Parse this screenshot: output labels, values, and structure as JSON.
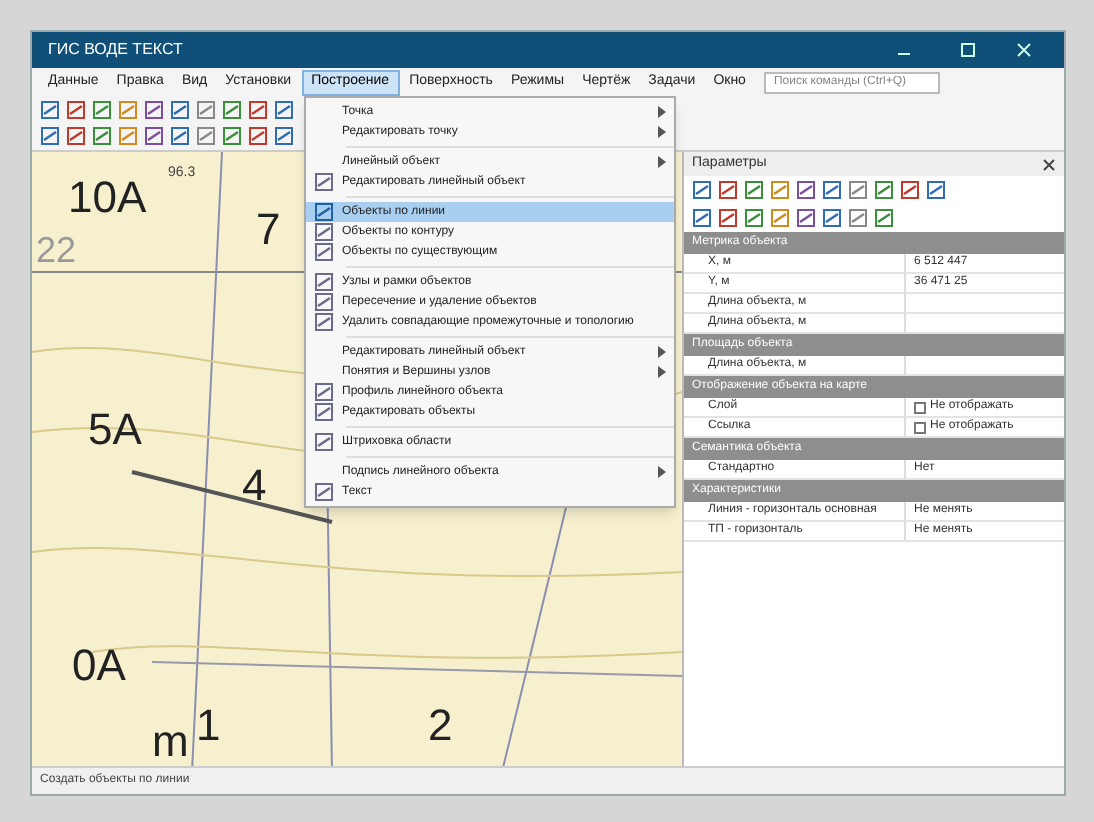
{
  "window": {
    "title": "ГИС ВОДЕ ТЕКСТ"
  },
  "menu_bar": [
    {
      "label": "Данные",
      "selected": false
    },
    {
      "label": "Правка",
      "selected": false
    },
    {
      "label": "Вид",
      "selected": false
    },
    {
      "label": "Установки",
      "selected": false
    },
    {
      "label": "Построение",
      "selected": true
    },
    {
      "label": "Поверхность",
      "selected": false
    },
    {
      "label": "Режимы",
      "selected": false
    },
    {
      "label": "Чертёж",
      "selected": false
    },
    {
      "label": "Задачи",
      "selected": false
    },
    {
      "label": "Окно",
      "selected": false
    }
  ],
  "search": {
    "placeholder": "Поиск команды (Ctrl+Q)"
  },
  "map": {
    "labels": [
      {
        "text": "10A",
        "kind": "big"
      },
      {
        "text": "96.3",
        "kind": "small"
      },
      {
        "text": "7",
        "kind": "big"
      },
      {
        "text": "22",
        "kind": "grid"
      },
      {
        "text": "5A",
        "kind": "big"
      },
      {
        "text": "4",
        "kind": "big"
      },
      {
        "text": "0A",
        "kind": "big"
      },
      {
        "text": "1",
        "kind": "big"
      },
      {
        "text": "2",
        "kind": "big"
      },
      {
        "text": "m",
        "kind": "big"
      }
    ]
  },
  "menu": [
    {
      "kind": "item",
      "label": "Точка",
      "submenu": true,
      "selected": false,
      "icon": false
    },
    {
      "kind": "item",
      "label": "Редактировать точку",
      "submenu": true,
      "selected": false,
      "icon": false
    },
    {
      "kind": "separator"
    },
    {
      "kind": "item",
      "label": "Линейный объект",
      "submenu": true,
      "selected": false,
      "icon": false
    },
    {
      "kind": "item",
      "label": "Редактировать линейный объект",
      "submenu": false,
      "selected": false,
      "icon": true
    },
    {
      "kind": "separator"
    },
    {
      "kind": "item",
      "label": "Объекты по линии",
      "submenu": false,
      "selected": true,
      "icon": true
    },
    {
      "kind": "item",
      "label": "Объекты по контуру",
      "submenu": false,
      "selected": false,
      "icon": true
    },
    {
      "kind": "item",
      "label": "Объекты по существующим",
      "submenu": false,
      "selected": false,
      "icon": true
    },
    {
      "kind": "separator"
    },
    {
      "kind": "item",
      "label": "Узлы и рамки объектов",
      "submenu": false,
      "selected": false,
      "icon": true
    },
    {
      "kind": "item",
      "label": "Пересечение и удаление объектов",
      "submenu": false,
      "selected": false,
      "icon": true
    },
    {
      "kind": "item",
      "label": "Удалить совпадающие промежуточные и топологию",
      "submenu": false,
      "selected": false,
      "icon": true
    },
    {
      "kind": "separator"
    },
    {
      "kind": "item",
      "label": "Редактировать линейный объект",
      "submenu": true,
      "selected": false,
      "icon": false
    },
    {
      "kind": "item",
      "label": "Понятия и Вершины узлов",
      "submenu": true,
      "selected": false,
      "icon": false
    },
    {
      "kind": "item",
      "label": "Профиль линейного объекта",
      "submenu": false,
      "selected": false,
      "icon": true
    },
    {
      "kind": "item",
      "label": "Редактировать объекты",
      "submenu": false,
      "selected": false,
      "icon": true
    },
    {
      "kind": "separator"
    },
    {
      "kind": "item",
      "label": "Штриховка области",
      "submenu": false,
      "selected": false,
      "icon": true
    },
    {
      "kind": "separator"
    },
    {
      "kind": "item",
      "label": "Подпись линейного объекта",
      "submenu": true,
      "selected": false,
      "icon": false
    },
    {
      "kind": "item",
      "label": "Текст",
      "submenu": false,
      "selected": false,
      "icon": true
    }
  ],
  "panel": {
    "title": "Параметры",
    "sections": [
      {
        "title": "Метрика объекта",
        "rows": [
          {
            "kind": "text",
            "name": "X, м",
            "value": "6 512 447"
          },
          {
            "kind": "text",
            "name": "Y, м",
            "value": "36 471 25"
          },
          {
            "kind": "text",
            "name": "Длина объекта, м"
          },
          {
            "kind": "text",
            "name": "Длина объекта, м"
          }
        ]
      },
      {
        "title": "Площадь объекта",
        "rows": [
          {
            "kind": "text",
            "name": "Длина объекта, м"
          }
        ]
      },
      {
        "title": "Отображение объекта на карте",
        "rows": [
          {
            "kind": "check",
            "name": "Слой",
            "value": "Не отображать",
            "checked": false
          },
          {
            "kind": "check",
            "name": "Ссылка",
            "value": "Не отображать",
            "checked": false
          }
        ]
      },
      {
        "title": "Семантика объекта",
        "rows": [
          {
            "kind": "text",
            "name": "Стандартно",
            "value": "Нет"
          }
        ]
      },
      {
        "title": "Характеристики",
        "rows": [
          {
            "kind": "text",
            "name": "Линия - горизонталь основная",
            "value": "Не менять"
          },
          {
            "kind": "text",
            "name": "ТП - горизонталь",
            "value": "Не менять"
          }
        ]
      }
    ]
  },
  "status_bar": "Создать объекты по линии"
}
